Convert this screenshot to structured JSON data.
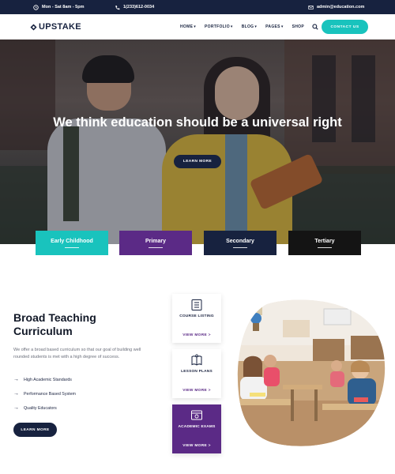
{
  "topbar": {
    "hours": "Mon - Sat 8am - 5pm",
    "phone": "1(233)612-0034",
    "email": "admin@education.com"
  },
  "header": {
    "logo": "UPSTAKE",
    "nav": [
      {
        "label": "HOME",
        "dropdown": true
      },
      {
        "label": "PORTFOLIO",
        "dropdown": true
      },
      {
        "label": "BLOG",
        "dropdown": true
      },
      {
        "label": "PAGES",
        "dropdown": true
      },
      {
        "label": "SHOP",
        "dropdown": false
      }
    ],
    "contact_label": "CONTACT US"
  },
  "hero": {
    "title": "We think education should be a universal right",
    "button_label": "LEARN MORE"
  },
  "categories": [
    {
      "label": "Early Childhood",
      "color": "#19c3bd"
    },
    {
      "label": "Primary",
      "color": "#5b2a86"
    },
    {
      "label": "Secondary",
      "color": "#17223f"
    },
    {
      "label": "Tertiary",
      "color": "#141414"
    }
  ],
  "section": {
    "title": "Broad Teaching Curriculum",
    "text": "We offer a broad based curriculum so that our goal of building well rounded students is met with a high degree of success.",
    "features": [
      "High Academic Standards",
      "Performance Based System",
      "Quality Educators"
    ],
    "button_label": "LEARN MORE"
  },
  "cards": [
    {
      "icon": "list-icon",
      "label": "COURSE LISTING",
      "more": "VIEW MORE >",
      "active": false
    },
    {
      "icon": "book-icon",
      "label": "LESSON PLANS",
      "more": "VIEW MORE >",
      "active": false
    },
    {
      "icon": "browser-icon",
      "label": "ACADEMIC EXAMS",
      "more": "VIEW MORE >",
      "active": true
    }
  ],
  "colors": {
    "navy": "#17223f",
    "teal": "#19c3bd",
    "purple": "#5b2a86"
  }
}
